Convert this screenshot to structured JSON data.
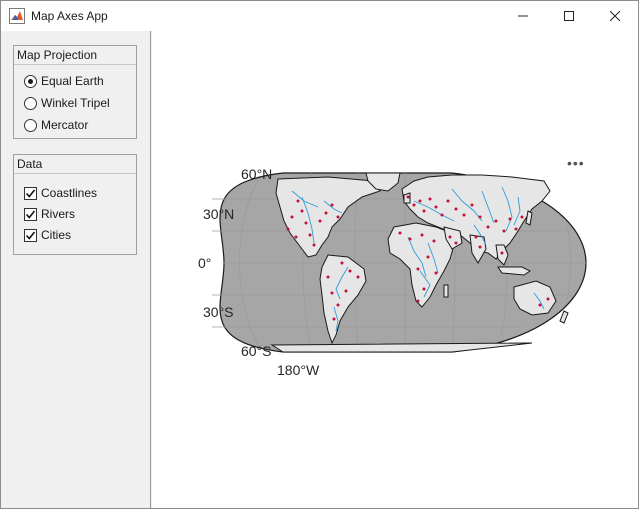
{
  "window": {
    "title": "Map Axes App"
  },
  "projection_panel": {
    "title": "Map Projection",
    "options": [
      {
        "label": "Equal Earth",
        "selected": true
      },
      {
        "label": "Winkel Tripel",
        "selected": false
      },
      {
        "label": "Mercator",
        "selected": false
      }
    ]
  },
  "data_panel": {
    "title": "Data",
    "options": [
      {
        "label": "Coastlines",
        "checked": true
      },
      {
        "label": "Rivers",
        "checked": true
      },
      {
        "label": "Cities",
        "checked": true
      }
    ]
  },
  "map": {
    "lat_labels": [
      "60°N",
      "30°N",
      "0°",
      "30°S",
      "60°S"
    ],
    "lon_label": "180°W",
    "toolbar_icon": "more-options-icon",
    "colors": {
      "ocean": "#a6a6a6",
      "land": "#e6e6e6",
      "rivers": "#2f9bd8",
      "cities": "#c4103a",
      "graticule": "#9a9a9a"
    }
  }
}
